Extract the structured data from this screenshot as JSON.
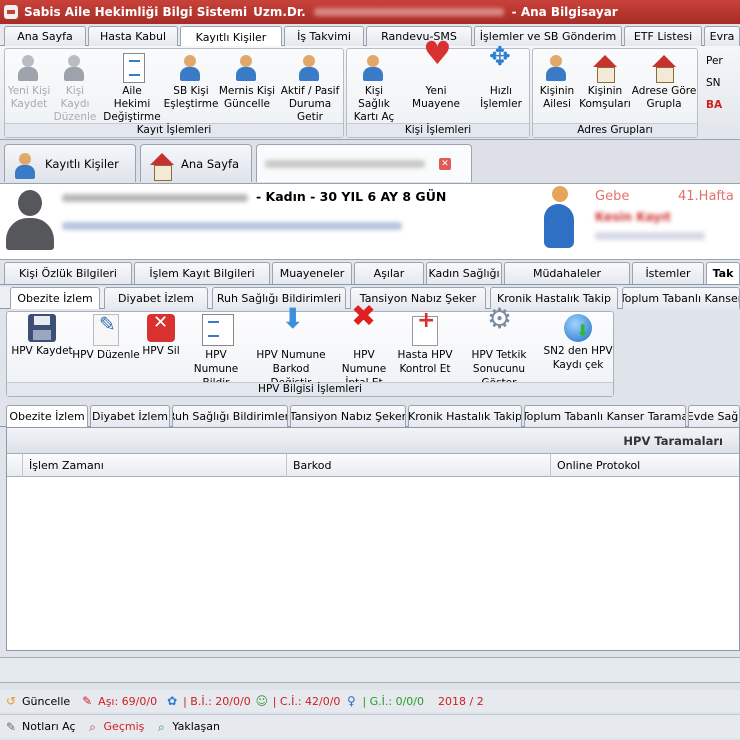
{
  "title": {
    "app": "Sabis Aile Hekimliği Bilgi Sistemi",
    "user": "Uzm.Dr.",
    "computer": "- Ana Bilgisayar"
  },
  "menu_tabs": [
    "Ana Sayfa",
    "Hasta Kabul",
    "Kayıtlı Kişiler",
    "İş Takvimi",
    "Randevu-SMS",
    "İşlemler ve SB Gönderim",
    "ETF Listesi",
    "Evra"
  ],
  "ribbon": {
    "kayit": {
      "title": "Kayıt İşlemleri",
      "buttons": [
        "Yeni Kişi Kaydet",
        "Kişi Kaydı Düzenle",
        "Aile Hekimi Değiştirme",
        "SB Kişi Eşleştirme",
        "Mernis Kişi Güncelle",
        "Aktif / Pasif Duruma Getir"
      ]
    },
    "kisi": {
      "title": "Kişi İşlemleri",
      "buttons": [
        "Kişi Sağlık Kartı Aç",
        "Yeni Muayene",
        "Hızlı İşlemler"
      ]
    },
    "adres": {
      "title": "Adres Grupları",
      "buttons": [
        "Kişinin Ailesi",
        "Kişinin Komşuları",
        "Adrese Göre Grupla"
      ]
    },
    "side": [
      "Per",
      "SN",
      "BA"
    ]
  },
  "doc_tabs": [
    "Kayıtlı Kişiler",
    "Ana Sayfa"
  ],
  "patient": {
    "info": "- Kadın - 30 YIL 6 AY 8 GÜN",
    "gebe": "Gebe",
    "hafta": "41.Hafta",
    "kesin": "Kesin Kayıt"
  },
  "tabs_main": [
    "Kişi Özlük Bilgileri",
    "İşlem Kayıt Bilgileri",
    "Muayeneler",
    "Aşılar",
    "Kadın Sağlığı",
    "Müdahaleler",
    "İstemler",
    "Tak"
  ],
  "tabs_sub": [
    "Obezite İzlem",
    "Diyabet İzlem",
    "Ruh Sağlığı Bildirimleri",
    "Tansiyon Nabız Şeker",
    "Kronik Hastalık Takip",
    "Toplum Tabanlı Kanser"
  ],
  "hpv": {
    "title": "HPV Bilgisi İşlemleri",
    "buttons": [
      "HPV Kaydet",
      "HPV Düzenle",
      "HPV Sil",
      "HPV Numune Bildir",
      "HPV Numune Barkod Değiştir",
      "HPV Numune İptal Et",
      "Hasta HPV Kontrol Et",
      "HPV Tetkik Sonucunu Göster",
      "SN2 den HPV Kaydı çek"
    ]
  },
  "tabs_lower": [
    "Obezite İzlem",
    "Diyabet İzlem",
    "Ruh Sağlığı Bildirimleri",
    "Tansiyon Nabız Şeker",
    "Kronik Hastalık Takip",
    "Toplum Tabanlı Kanser Tarama",
    "Evde Sağl"
  ],
  "grid": {
    "title": "HPV Taramaları",
    "columns": [
      "İşlem Zamanı",
      "Barkod",
      "Online Protokol"
    ],
    "rows": []
  },
  "status": {
    "guncelle": "Güncelle",
    "asi": "Aşı: 69/0/0",
    "bi": "| B.İ.: 20/0/0",
    "ci": "| C.İ.: 42/0/0",
    "gi": "| G.İ.: 0/0/0",
    "year": "2018 / 2",
    "notlar": "Notları Aç",
    "gecmis": "Geçmiş",
    "yaklasan": "Yaklaşan"
  }
}
